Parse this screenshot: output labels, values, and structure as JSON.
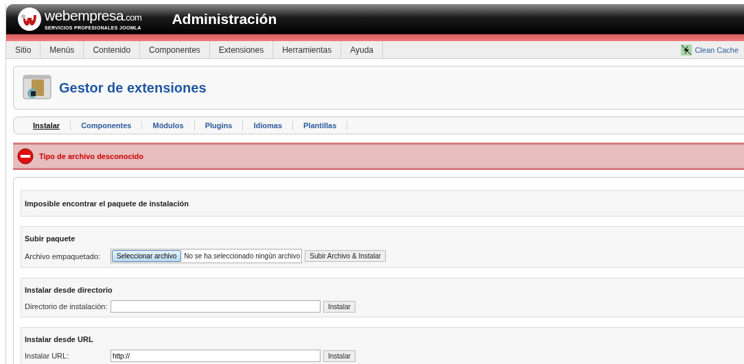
{
  "header": {
    "brand": "webempresa",
    "brand_suffix": ".com",
    "tagline": "SERVICIOS PROFESIONALES JOOMLA",
    "title": "Administración"
  },
  "menu": [
    {
      "label": "Sitio"
    },
    {
      "label": "Menús"
    },
    {
      "label": "Contenido"
    },
    {
      "label": "Componentes"
    },
    {
      "label": "Extensiones"
    },
    {
      "label": "Herramientas"
    },
    {
      "label": "Ayuda"
    }
  ],
  "clean_cache": "Clean Cache",
  "page_title": "Gestor de extensiones",
  "submenu": [
    {
      "label": "Instalar",
      "selected": true
    },
    {
      "label": "Componentes",
      "selected": false
    },
    {
      "label": "Módulos",
      "selected": false
    },
    {
      "label": "Plugins",
      "selected": false
    },
    {
      "label": "Idiomas",
      "selected": false
    },
    {
      "label": "Plantillas",
      "selected": false
    }
  ],
  "error_message": "Tipo de archivo desconocido",
  "sections": [
    {
      "kind": "notice",
      "title": "Imposible encontrar el paquete de instalación"
    },
    {
      "kind": "file",
      "title": "Subir paquete",
      "label": "Archivo empaquetado:",
      "choose_button": "Seleccionar archivo",
      "file_status": "No se ha seleccionado ningún archivo",
      "button": "Subir Archivo & Instalar"
    },
    {
      "kind": "text",
      "title": "Instalar desde directorio",
      "label": "Directorio de instalación:",
      "button": "Instalar"
    },
    {
      "kind": "text",
      "title": "Instalar desde URL",
      "label": "Instalar URL:",
      "value": "http://",
      "button": "Instalar"
    }
  ]
}
